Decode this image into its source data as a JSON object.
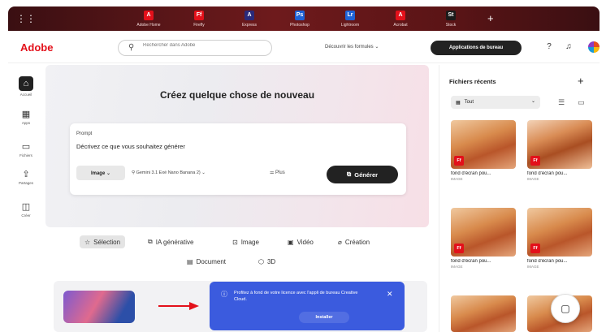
{
  "topbar": {
    "apps": [
      {
        "label": "Adobe Home",
        "icon": "adobe-home-icon",
        "glyph": "A",
        "color": "#e3101a"
      },
      {
        "label": "Firefly",
        "icon": "firefly-icon",
        "glyph": "Ff",
        "color": "#e3101a"
      },
      {
        "label": "Express",
        "icon": "express-icon",
        "glyph": "A",
        "color": "#2a2a7a"
      },
      {
        "label": "Photoshop",
        "icon": "photoshop-icon",
        "glyph": "Ps",
        "color": "#1f63d6"
      },
      {
        "label": "Lightroom",
        "icon": "lightroom-icon",
        "glyph": "Lr",
        "color": "#1f63d6"
      },
      {
        "label": "Acrobat",
        "icon": "acrobat-icon",
        "glyph": "A",
        "color": "#e3101a"
      },
      {
        "label": "Stock",
        "icon": "stock-icon",
        "glyph": "St",
        "color": "#1a1a1a"
      }
    ],
    "add_app": "+"
  },
  "header": {
    "logo": "Adobe",
    "search_placeholder": "Rechercher dans Adobe",
    "discover": "Découvrir les formules ⌄",
    "desktop_apps": "Applications de bureau"
  },
  "rail": {
    "items": [
      {
        "label": "Accueil",
        "icon": "home-icon",
        "glyph": "⌂"
      },
      {
        "label": "Apps",
        "icon": "apps-icon",
        "glyph": "▦"
      },
      {
        "label": "Fichiers",
        "icon": "folder-icon",
        "glyph": "▭"
      },
      {
        "label": "Partages",
        "icon": "share-icon",
        "glyph": "⇪"
      },
      {
        "label": "Créer",
        "icon": "create-icon",
        "glyph": "◫"
      }
    ]
  },
  "hero": {
    "title": "Créez quelque chose de nouveau",
    "prompt_label": "Prompt",
    "prompt_text": "Décrivez ce que vous souhaitez générer",
    "type_select": "Image ⌄",
    "model": "Gemini 3.1 Exé Nano Banana 2) ⌄",
    "more": "Plus",
    "generate": "Générer"
  },
  "categories": [
    {
      "label": "Sélection",
      "icon": "star-icon",
      "glyph": "☆",
      "selected": true
    },
    {
      "label": "IA générative",
      "icon": "ai-icon",
      "glyph": "⧉",
      "selected": false
    },
    {
      "label": "Image",
      "icon": "image-icon",
      "glyph": "⊡",
      "selected": false
    },
    {
      "label": "Vidéo",
      "icon": "video-icon",
      "glyph": "▣",
      "selected": false
    },
    {
      "label": "Création",
      "icon": "brush-icon",
      "glyph": "⌀",
      "selected": false
    },
    {
      "label": "Document",
      "icon": "document-icon",
      "glyph": "▤",
      "selected": false
    },
    {
      "label": "3D",
      "icon": "cube-icon",
      "glyph": "⬡",
      "selected": false
    }
  ],
  "toast": {
    "message": "Profitez à fond de votre licence avec l'appli de bureau Creative Cloud.",
    "action": "Installer",
    "close": "✕"
  },
  "recent": {
    "title": "Fichiers récents",
    "add": "+",
    "filter": "Tout",
    "files": [
      {
        "name": "fond d'écran pou...",
        "meta": "IMAGE",
        "badge": "Ff"
      },
      {
        "name": "fond d'écran pou...",
        "meta": "IMAGE",
        "badge": "Ff"
      },
      {
        "name": "fond d'écran pou...",
        "meta": "IMAGE",
        "badge": "Ff"
      },
      {
        "name": "fond d'écran pou...",
        "meta": "IMAGE",
        "badge": "Ff"
      }
    ]
  }
}
